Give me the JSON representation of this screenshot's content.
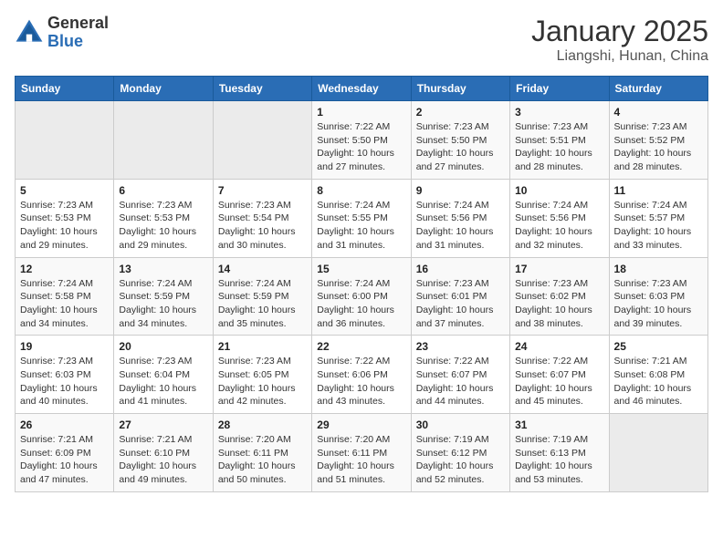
{
  "logo": {
    "general": "General",
    "blue": "Blue"
  },
  "title": "January 2025",
  "subtitle": "Liangshi, Hunan, China",
  "weekdays": [
    "Sunday",
    "Monday",
    "Tuesday",
    "Wednesday",
    "Thursday",
    "Friday",
    "Saturday"
  ],
  "weeks": [
    [
      {
        "day": "",
        "detail": ""
      },
      {
        "day": "",
        "detail": ""
      },
      {
        "day": "",
        "detail": ""
      },
      {
        "day": "1",
        "detail": "Sunrise: 7:22 AM\nSunset: 5:50 PM\nDaylight: 10 hours and 27 minutes."
      },
      {
        "day": "2",
        "detail": "Sunrise: 7:23 AM\nSunset: 5:50 PM\nDaylight: 10 hours and 27 minutes."
      },
      {
        "day": "3",
        "detail": "Sunrise: 7:23 AM\nSunset: 5:51 PM\nDaylight: 10 hours and 28 minutes."
      },
      {
        "day": "4",
        "detail": "Sunrise: 7:23 AM\nSunset: 5:52 PM\nDaylight: 10 hours and 28 minutes."
      }
    ],
    [
      {
        "day": "5",
        "detail": "Sunrise: 7:23 AM\nSunset: 5:53 PM\nDaylight: 10 hours and 29 minutes."
      },
      {
        "day": "6",
        "detail": "Sunrise: 7:23 AM\nSunset: 5:53 PM\nDaylight: 10 hours and 29 minutes."
      },
      {
        "day": "7",
        "detail": "Sunrise: 7:23 AM\nSunset: 5:54 PM\nDaylight: 10 hours and 30 minutes."
      },
      {
        "day": "8",
        "detail": "Sunrise: 7:24 AM\nSunset: 5:55 PM\nDaylight: 10 hours and 31 minutes."
      },
      {
        "day": "9",
        "detail": "Sunrise: 7:24 AM\nSunset: 5:56 PM\nDaylight: 10 hours and 31 minutes."
      },
      {
        "day": "10",
        "detail": "Sunrise: 7:24 AM\nSunset: 5:56 PM\nDaylight: 10 hours and 32 minutes."
      },
      {
        "day": "11",
        "detail": "Sunrise: 7:24 AM\nSunset: 5:57 PM\nDaylight: 10 hours and 33 minutes."
      }
    ],
    [
      {
        "day": "12",
        "detail": "Sunrise: 7:24 AM\nSunset: 5:58 PM\nDaylight: 10 hours and 34 minutes."
      },
      {
        "day": "13",
        "detail": "Sunrise: 7:24 AM\nSunset: 5:59 PM\nDaylight: 10 hours and 34 minutes."
      },
      {
        "day": "14",
        "detail": "Sunrise: 7:24 AM\nSunset: 5:59 PM\nDaylight: 10 hours and 35 minutes."
      },
      {
        "day": "15",
        "detail": "Sunrise: 7:24 AM\nSunset: 6:00 PM\nDaylight: 10 hours and 36 minutes."
      },
      {
        "day": "16",
        "detail": "Sunrise: 7:23 AM\nSunset: 6:01 PM\nDaylight: 10 hours and 37 minutes."
      },
      {
        "day": "17",
        "detail": "Sunrise: 7:23 AM\nSunset: 6:02 PM\nDaylight: 10 hours and 38 minutes."
      },
      {
        "day": "18",
        "detail": "Sunrise: 7:23 AM\nSunset: 6:03 PM\nDaylight: 10 hours and 39 minutes."
      }
    ],
    [
      {
        "day": "19",
        "detail": "Sunrise: 7:23 AM\nSunset: 6:03 PM\nDaylight: 10 hours and 40 minutes."
      },
      {
        "day": "20",
        "detail": "Sunrise: 7:23 AM\nSunset: 6:04 PM\nDaylight: 10 hours and 41 minutes."
      },
      {
        "day": "21",
        "detail": "Sunrise: 7:23 AM\nSunset: 6:05 PM\nDaylight: 10 hours and 42 minutes."
      },
      {
        "day": "22",
        "detail": "Sunrise: 7:22 AM\nSunset: 6:06 PM\nDaylight: 10 hours and 43 minutes."
      },
      {
        "day": "23",
        "detail": "Sunrise: 7:22 AM\nSunset: 6:07 PM\nDaylight: 10 hours and 44 minutes."
      },
      {
        "day": "24",
        "detail": "Sunrise: 7:22 AM\nSunset: 6:07 PM\nDaylight: 10 hours and 45 minutes."
      },
      {
        "day": "25",
        "detail": "Sunrise: 7:21 AM\nSunset: 6:08 PM\nDaylight: 10 hours and 46 minutes."
      }
    ],
    [
      {
        "day": "26",
        "detail": "Sunrise: 7:21 AM\nSunset: 6:09 PM\nDaylight: 10 hours and 47 minutes."
      },
      {
        "day": "27",
        "detail": "Sunrise: 7:21 AM\nSunset: 6:10 PM\nDaylight: 10 hours and 49 minutes."
      },
      {
        "day": "28",
        "detail": "Sunrise: 7:20 AM\nSunset: 6:11 PM\nDaylight: 10 hours and 50 minutes."
      },
      {
        "day": "29",
        "detail": "Sunrise: 7:20 AM\nSunset: 6:11 PM\nDaylight: 10 hours and 51 minutes."
      },
      {
        "day": "30",
        "detail": "Sunrise: 7:19 AM\nSunset: 6:12 PM\nDaylight: 10 hours and 52 minutes."
      },
      {
        "day": "31",
        "detail": "Sunrise: 7:19 AM\nSunset: 6:13 PM\nDaylight: 10 hours and 53 minutes."
      },
      {
        "day": "",
        "detail": ""
      }
    ]
  ]
}
